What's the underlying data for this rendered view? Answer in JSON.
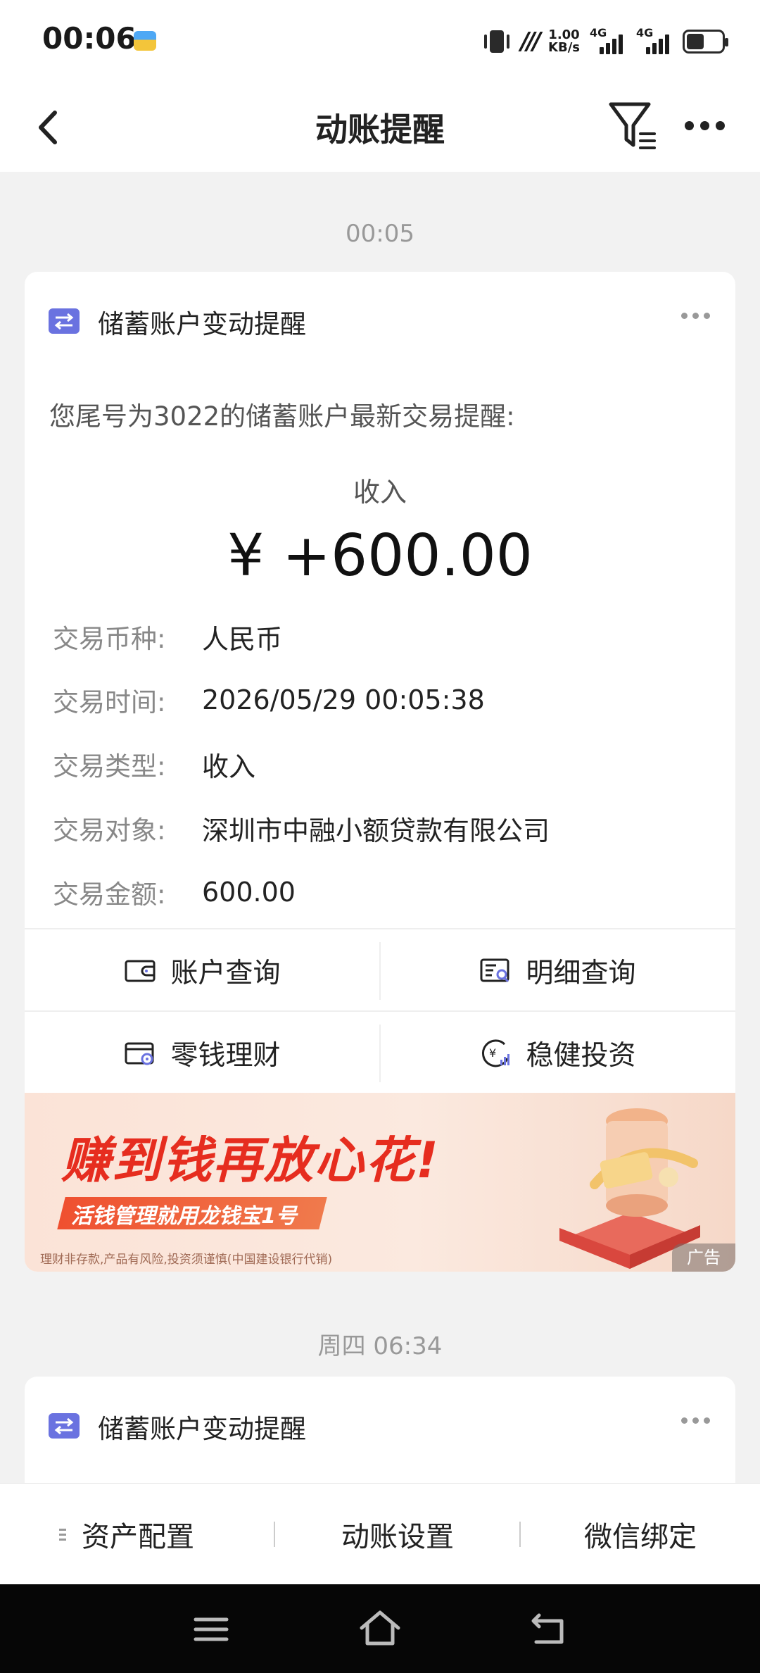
{
  "status_bar": {
    "time": "00:06",
    "net_speed_value": "1.00",
    "net_speed_unit": "KB/s",
    "sim1_tag": "4G",
    "sim2_tag": "4G"
  },
  "header": {
    "title": "动账提醒"
  },
  "messages": [
    {
      "timestamp": "00:05",
      "card_title": "储蓄账户变动提醒",
      "intro": "您尾号为3022的储蓄账户最新交易提醒:",
      "tx_type": "收入",
      "amount": "¥ +600.00",
      "details": [
        {
          "label": "交易币种:",
          "value": "人民币"
        },
        {
          "label": "交易时间:",
          "value": "2026/05/29 00:05:38"
        },
        {
          "label": "交易类型:",
          "value": "收入"
        },
        {
          "label": "交易对象:",
          "value": "深圳市中融小额贷款有限公司"
        },
        {
          "label": "交易金额:",
          "value": "600.00"
        }
      ],
      "actions": [
        {
          "label": "账户查询",
          "icon": "wallet-icon"
        },
        {
          "label": "明细查询",
          "icon": "statement-search-icon"
        },
        {
          "label": "零钱理财",
          "icon": "wealth-icon"
        },
        {
          "label": "稳健投资",
          "icon": "investment-icon"
        }
      ],
      "banner": {
        "headline": "赚到钱再放心花!",
        "subline": "活钱管理就用龙钱宝1号",
        "disclaimer": "理财非存款,产品有风险,投资须谨慎(中国建设银行代销)",
        "ad_tag": "广告"
      }
    },
    {
      "timestamp": "周四 06:34",
      "card_title": "储蓄账户变动提醒"
    }
  ],
  "bottom_tabs": [
    {
      "label": "资产配置"
    },
    {
      "label": "动账设置"
    },
    {
      "label": "微信绑定"
    }
  ],
  "colors": {
    "accent": "#6a72e0",
    "banner_red": "#e62d1f",
    "page_bg": "#f2f2f2"
  }
}
